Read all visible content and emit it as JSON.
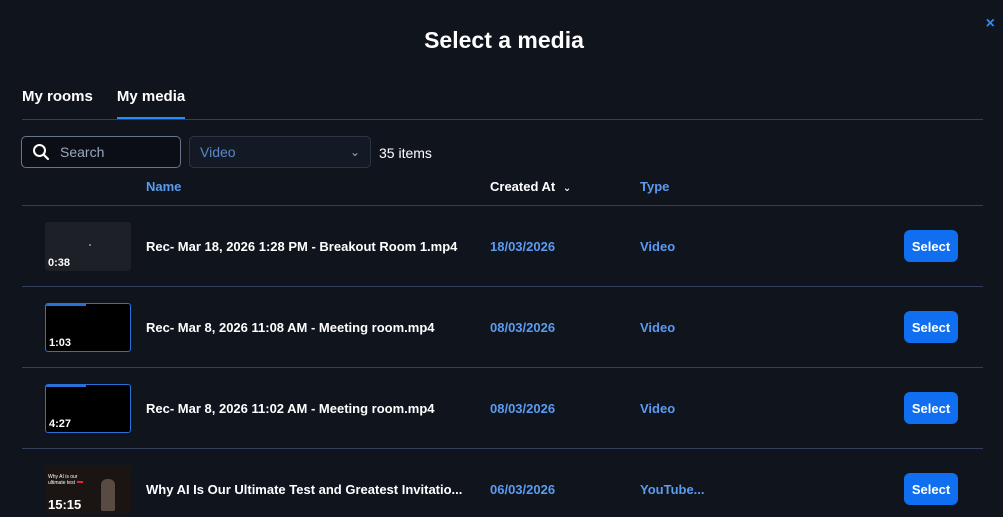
{
  "dialog": {
    "title": "Select a media",
    "close_icon": "×"
  },
  "tabs": [
    {
      "label": "My rooms",
      "active": false
    },
    {
      "label": "My media",
      "active": true
    }
  ],
  "filters": {
    "search_placeholder": "Search",
    "type_selected": "Video",
    "count_text": "35 items"
  },
  "table": {
    "headers": {
      "name": "Name",
      "created": "Created At",
      "created_sort_icon": "chevron-down-icon",
      "type": "Type"
    },
    "rows": [
      {
        "duration": "0:38",
        "name": "Rec- Mar 18, 2026 1:28 PM - Breakout Room 1.mp4",
        "created": "18/03/2026",
        "type": "Video",
        "action": "Select"
      },
      {
        "duration": "1:03",
        "name": "Rec- Mar 8, 2026 11:08 AM - Meeting room.mp4",
        "created": "08/03/2026",
        "type": "Video",
        "action": "Select"
      },
      {
        "duration": "4:27",
        "name": "Rec- Mar 8, 2026 11:02 AM - Meeting room.mp4",
        "created": "08/03/2026",
        "type": "Video",
        "action": "Select"
      },
      {
        "duration": "15:15",
        "name": "Why AI Is Our Ultimate Test and Greatest Invitatio...",
        "created": "06/03/2026",
        "type": "YouTube...",
        "action": "Select",
        "thumb_text": "Why AI is our ultimate test"
      }
    ]
  },
  "colors": {
    "accent": "#0f6ff0",
    "link_blue": "#5b9bf0",
    "background": "#0f141d"
  }
}
